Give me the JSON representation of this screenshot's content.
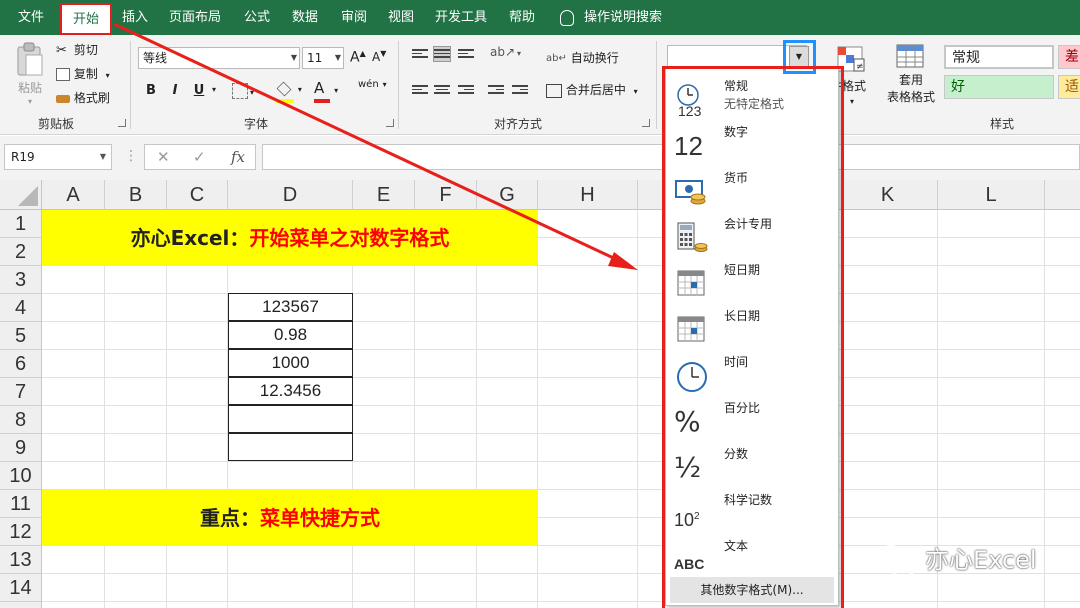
{
  "menu": {
    "items": [
      {
        "label": "文件"
      },
      {
        "label": "开始"
      },
      {
        "label": "插入"
      },
      {
        "label": "页面布局"
      },
      {
        "label": "公式"
      },
      {
        "label": "数据"
      },
      {
        "label": "审阅"
      },
      {
        "label": "视图"
      },
      {
        "label": "开发工具"
      },
      {
        "label": "帮助"
      }
    ],
    "active": "开始",
    "tell_me": "操作说明搜索"
  },
  "ribbon": {
    "clipboard": {
      "paste": "粘贴",
      "cut": "剪切",
      "copy": "复制",
      "format_painter": "格式刷",
      "group_label": "剪贴板"
    },
    "font": {
      "font_name": "等线",
      "font_size": "11",
      "grow": "A",
      "shrink": "A",
      "bold": "B",
      "italic": "I",
      "underline": "U",
      "font_color_glyph": "A",
      "phonetic": "wén",
      "group_label": "字体"
    },
    "alignment": {
      "wrap_text": "自动换行",
      "merge_center": "合并后居中",
      "group_label": "对齐方式"
    },
    "number": {
      "format_value": ""
    },
    "styles_area": {
      "conditional_format_partial": "件格式",
      "table_format_line1": "套用",
      "table_format_line2": "表格格式",
      "normal": "常规",
      "bad": "差",
      "good": "好",
      "neutral": "适",
      "group_label": "样式"
    }
  },
  "formula_bar": {
    "name_box": "R19",
    "fx": "fx",
    "cancel": "✕",
    "enter": "✓",
    "value": ""
  },
  "grid": {
    "columns": [
      "A",
      "B",
      "C",
      "D",
      "E",
      "F",
      "G",
      "H",
      "K",
      "L"
    ],
    "rows": [
      "1",
      "2",
      "3",
      "4",
      "5",
      "6",
      "7",
      "8",
      "9",
      "10",
      "11",
      "12",
      "13",
      "14"
    ],
    "banner1": {
      "prefix": "亦心Excel：",
      "highlight": "开始菜单之对数字格式"
    },
    "banner2": {
      "prefix": "重点：",
      "highlight": "菜单快捷方式"
    },
    "d_values": [
      "123567",
      "0.98",
      "1000",
      "12.3456",
      "",
      ""
    ]
  },
  "number_format_dropdown": {
    "items": [
      {
        "label": "常规",
        "sub": "无特定格式",
        "icon": "general-clock-123-icon",
        "icon_text": "123"
      },
      {
        "label": "数字",
        "icon": "number-12-icon",
        "icon_text": "12"
      },
      {
        "label": "货币",
        "icon": "currency-icon"
      },
      {
        "label": "会计专用",
        "icon": "accounting-icon"
      },
      {
        "label": "短日期",
        "icon": "short-date-calendar-icon"
      },
      {
        "label": "长日期",
        "icon": "long-date-calendar-icon"
      },
      {
        "label": "时间",
        "icon": "time-clock-icon"
      },
      {
        "label": "百分比",
        "icon": "percent-icon",
        "icon_text": "%"
      },
      {
        "label": "分数",
        "icon": "fraction-icon",
        "icon_text": "½"
      },
      {
        "label": "科学记数",
        "icon": "scientific-icon",
        "icon_text": "10",
        "icon_sup": "2"
      },
      {
        "label": "文本",
        "icon": "text-abc-icon",
        "icon_text": "ABC"
      }
    ],
    "more": "其他数字格式(M)..."
  },
  "watermark": "亦心Excel",
  "colors": {
    "menubar": "#217346",
    "highlight_frame": "#e8201b",
    "dropdown_button_frame": "#1e90ff",
    "banner": "#ffff00",
    "banner_text_red": "#ff0000"
  }
}
